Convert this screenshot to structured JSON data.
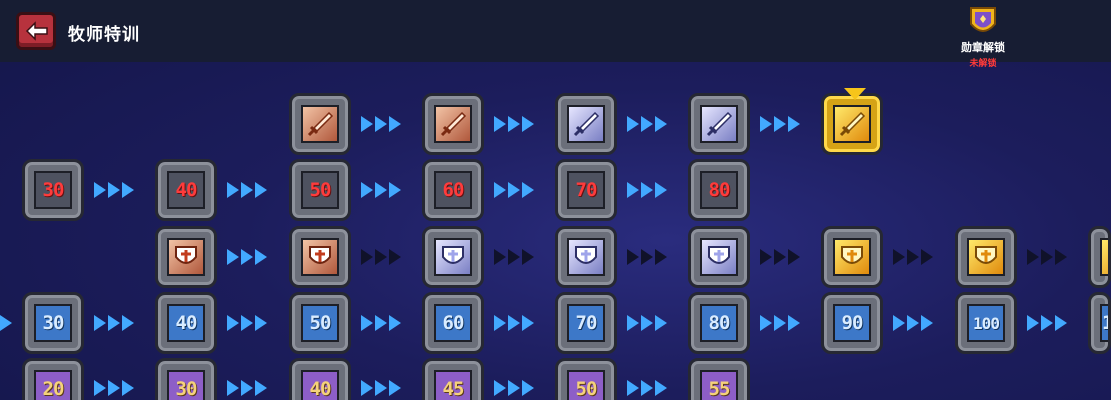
{
  "header": {
    "title": "牧师特训"
  },
  "medal": {
    "label": "勋章解锁",
    "status": "未解锁"
  },
  "rows": {
    "red_levels": [
      "30",
      "40",
      "50",
      "60",
      "70",
      "80"
    ],
    "blue_levels": [
      "30",
      "40",
      "50",
      "60",
      "70",
      "80",
      "90",
      "100",
      "1"
    ],
    "purple_levels": [
      "20",
      "30",
      "40",
      "45",
      "50",
      "55"
    ]
  },
  "icons": {
    "swords": [
      "sword-copper-icon",
      "sword-copper-icon",
      "sword-silver-icon",
      "sword-silver-icon",
      "sword-gold-icon"
    ],
    "shields": [
      "shield-copper-icon",
      "shield-copper-icon",
      "shield-silver-icon",
      "shield-silver-icon",
      "shield-silver-icon",
      "shield-gold-icon",
      "shield-gold-icon",
      "shield-gold-icon"
    ]
  },
  "colors": {
    "active_arrow": "#42a9ff",
    "inactive_arrow": "#10122a",
    "red_text": "#ff3b3b",
    "gold": "#f7c51a"
  }
}
